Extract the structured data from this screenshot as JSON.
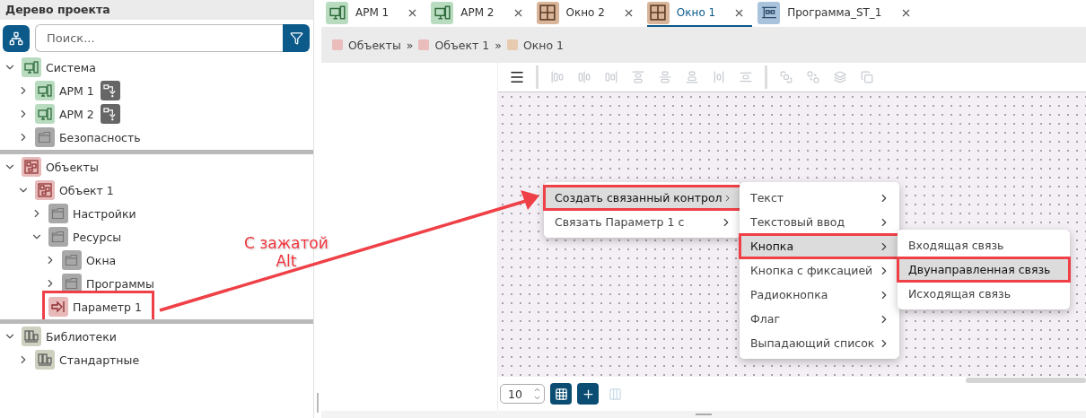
{
  "sidebar": {
    "title": "Дерево проекта",
    "search": {
      "placeholder": "Поиск..."
    },
    "groups": [
      {
        "nodes": [
          {
            "label": "Система",
            "kind": "system",
            "expanded": true,
            "children": [
              {
                "label": "АРМ 1",
                "kind": "workstation",
                "expanded": false,
                "deploy": true
              },
              {
                "label": "АРМ 2",
                "kind": "workstation",
                "expanded": false,
                "deploy": true
              },
              {
                "label": "Безопасность",
                "kind": "folder",
                "expanded": false
              }
            ]
          }
        ]
      },
      {
        "nodes": [
          {
            "label": "Объекты",
            "kind": "objects",
            "expanded": true,
            "children": [
              {
                "label": "Объект 1",
                "kind": "object",
                "expanded": true,
                "children": [
                  {
                    "label": "Настройки",
                    "kind": "folder",
                    "expanded": false
                  },
                  {
                    "label": "Ресурсы",
                    "kind": "folder",
                    "expanded": true,
                    "children": [
                      {
                        "label": "Окна",
                        "kind": "folder",
                        "expanded": false
                      },
                      {
                        "label": "Программы",
                        "kind": "folder",
                        "expanded": false
                      }
                    ]
                  },
                  {
                    "label": "Параметр 1",
                    "kind": "parameter",
                    "highlighted": true
                  }
                ]
              }
            ]
          }
        ]
      },
      {
        "nodes": [
          {
            "label": "Библиотеки",
            "kind": "library",
            "expanded": true,
            "children": [
              {
                "label": "Стандартные",
                "kind": "library",
                "expanded": false
              }
            ]
          }
        ]
      }
    ]
  },
  "tabs": [
    {
      "label": "АРМ 1",
      "kind": "workstation",
      "selected": false
    },
    {
      "label": "АРМ 2",
      "kind": "workstation",
      "selected": false
    },
    {
      "label": "Окно 2",
      "kind": "window",
      "selected": false
    },
    {
      "label": "Окно 1",
      "kind": "window",
      "selected": true
    },
    {
      "label": "Программа_ST_1",
      "kind": "program",
      "selected": false
    }
  ],
  "breadcrumb": {
    "separator": "»",
    "items": [
      {
        "label": "Объекты",
        "color": "#eabcbc"
      },
      {
        "label": "Объект 1",
        "color": "#eabcbc"
      },
      {
        "label": "Окно 1",
        "color": "#e6cbb0"
      }
    ]
  },
  "toolbar": {
    "tools": [
      {
        "kind": "menu",
        "disabled": false
      },
      {
        "kind": "align-left",
        "disabled": true
      },
      {
        "kind": "align-center",
        "disabled": true
      },
      {
        "kind": "align-right",
        "disabled": true
      },
      {
        "kind": "align-top",
        "disabled": true
      },
      {
        "kind": "align-middle",
        "disabled": true
      },
      {
        "kind": "align-bottom",
        "disabled": true
      },
      {
        "kind": "distribute-h",
        "disabled": true
      },
      {
        "kind": "distribute-v",
        "disabled": true
      },
      {
        "kind": "bring-front",
        "disabled": true
      },
      {
        "kind": "send-back",
        "disabled": true
      },
      {
        "kind": "forward",
        "disabled": true
      },
      {
        "kind": "backward",
        "disabled": true
      }
    ]
  },
  "context_menu": {
    "levels": [
      [
        {
          "label": "Создать связанный контрол",
          "submenu": true,
          "selected": true,
          "highlighted": true
        },
        {
          "label": "Связать Параметр 1 с",
          "submenu": true,
          "selected": false,
          "highlighted": false
        }
      ],
      [
        {
          "label": "Текст",
          "submenu": true,
          "selected": false,
          "highlighted": false
        },
        {
          "label": "Текстовый ввод",
          "submenu": true,
          "selected": false,
          "highlighted": false
        },
        {
          "label": "Кнопка",
          "submenu": true,
          "selected": true,
          "highlighted": true
        },
        {
          "label": "Кнопка с фиксацией",
          "submenu": true,
          "selected": false,
          "highlighted": false
        },
        {
          "label": "Радиокнопка",
          "submenu": true,
          "selected": false,
          "highlighted": false
        },
        {
          "label": "Флаг",
          "submenu": true,
          "selected": false,
          "highlighted": false
        },
        {
          "label": "Выпадающий список",
          "submenu": true,
          "selected": false,
          "highlighted": false
        }
      ],
      [
        {
          "label": "Входящая связь",
          "submenu": false,
          "selected": false,
          "highlighted": false
        },
        {
          "label": "Двунаправленная связь",
          "submenu": false,
          "selected": true,
          "highlighted": true
        },
        {
          "label": "Исходящая связь",
          "submenu": false,
          "selected": false,
          "highlighted": false
        }
      ]
    ]
  },
  "annotation": {
    "note": "С зажатой\nAlt"
  },
  "footer": {
    "grid_size": "10",
    "tools": [
      {
        "kind": "grid",
        "on": true,
        "disabled": false
      },
      {
        "kind": "snap",
        "on": true,
        "disabled": false
      },
      {
        "kind": "guides",
        "on": false,
        "disabled": true
      }
    ]
  }
}
